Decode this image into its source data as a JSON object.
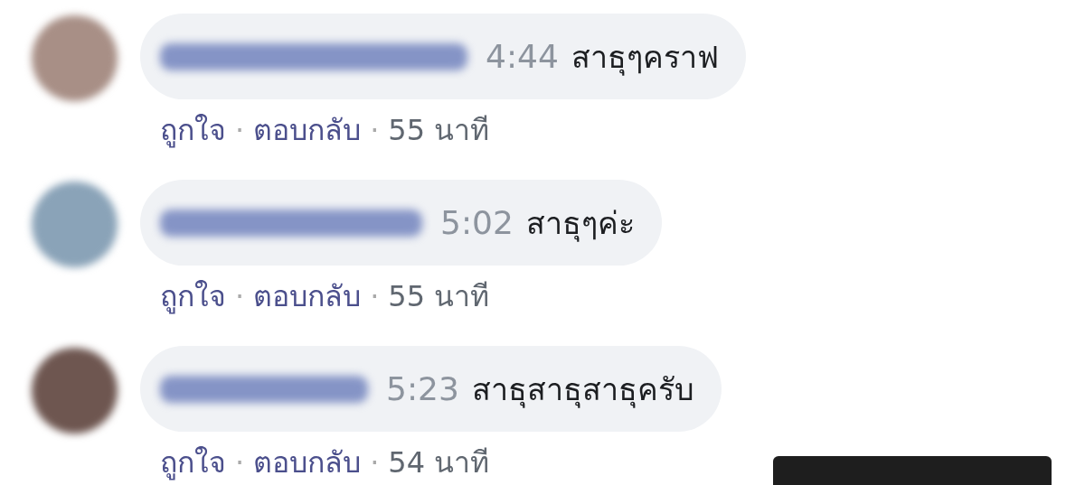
{
  "comments": [
    {
      "time": "4:44",
      "text": "สาธุๆคราฟ",
      "actions": [
        {
          "kind": "link",
          "label": "ถูกใจ"
        },
        {
          "kind": "separator",
          "label": "·"
        },
        {
          "kind": "link",
          "label": "ตอบกลับ"
        },
        {
          "kind": "separator",
          "label": "·"
        },
        {
          "kind": "age",
          "label": "55 นาที"
        }
      ]
    },
    {
      "time": "5:02",
      "text": "สาธุๆค่ะ",
      "actions": [
        {
          "kind": "link",
          "label": "ถูกใจ"
        },
        {
          "kind": "separator",
          "label": "·"
        },
        {
          "kind": "link",
          "label": "ตอบกลับ"
        },
        {
          "kind": "separator",
          "label": "·"
        },
        {
          "kind": "age",
          "label": "55 นาที"
        }
      ]
    },
    {
      "time": "5:23",
      "text": "สาธุสาธุสาธุครับ",
      "actions": [
        {
          "kind": "link",
          "label": "ถูกใจ"
        },
        {
          "kind": "separator",
          "label": "·"
        },
        {
          "kind": "link",
          "label": "ตอบกลับ"
        },
        {
          "kind": "separator",
          "label": "·"
        },
        {
          "kind": "age",
          "label": "54 นาที"
        }
      ]
    }
  ]
}
